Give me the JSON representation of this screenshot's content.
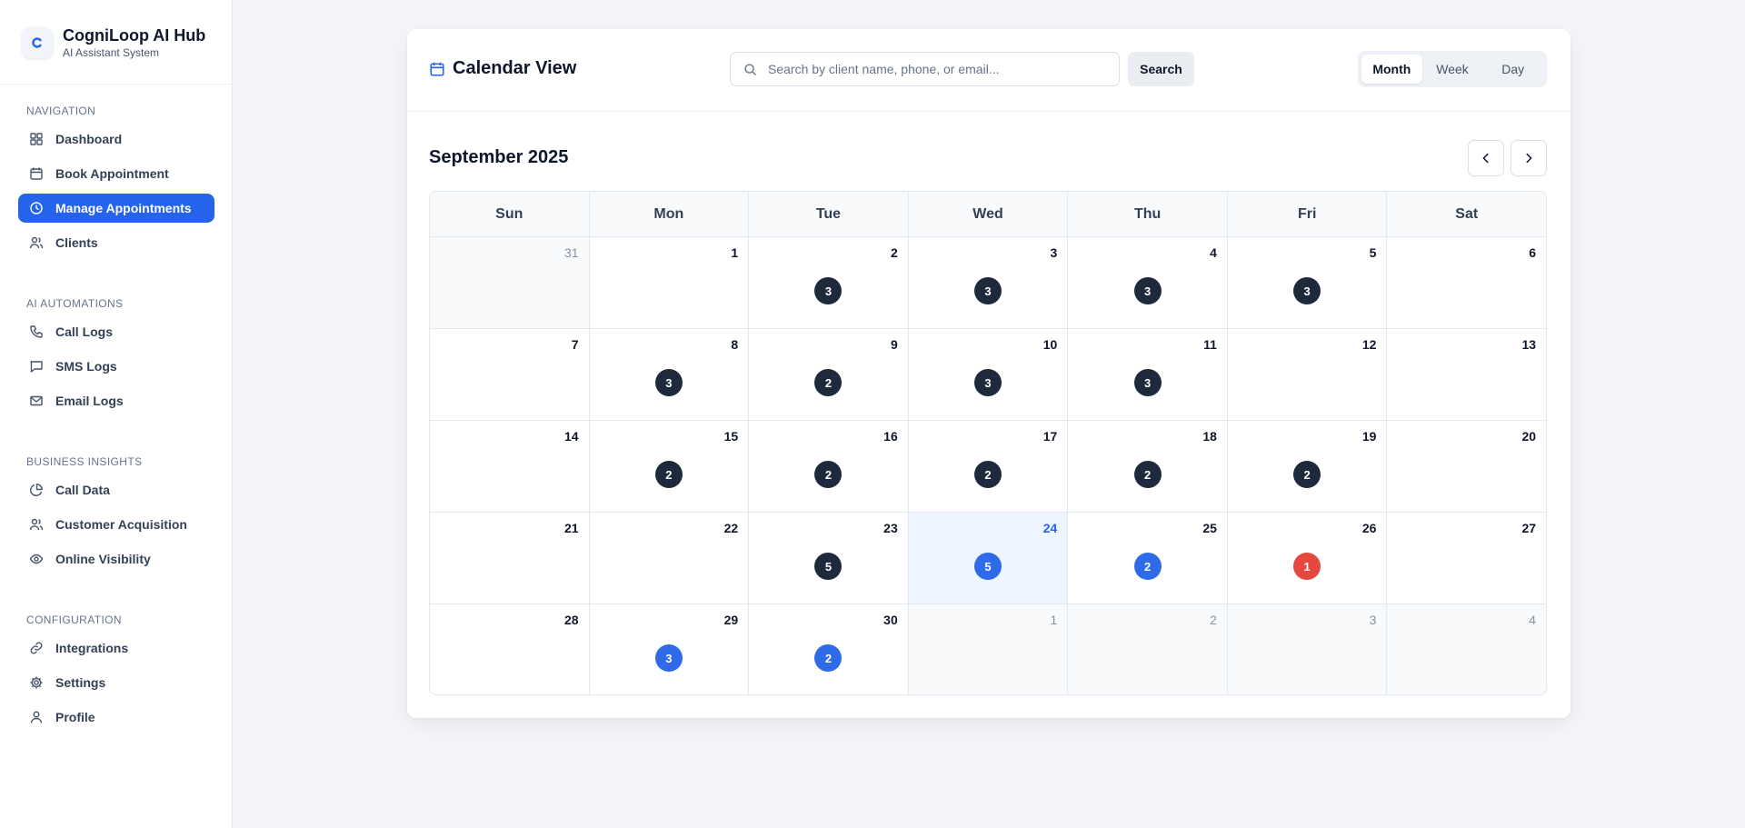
{
  "brand": {
    "name": "CogniLoop AI Hub",
    "subtitle": "AI Assistant System"
  },
  "sidebar": {
    "sections": [
      {
        "title": "NAVIGATION",
        "items": [
          {
            "label": "Dashboard",
            "icon": "dashboard-icon"
          },
          {
            "label": "Book Appointment",
            "icon": "calendar-icon"
          },
          {
            "label": "Manage Appointments",
            "icon": "clock-icon",
            "active": true
          },
          {
            "label": "Clients",
            "icon": "users-icon"
          }
        ]
      },
      {
        "title": "AI AUTOMATIONS",
        "items": [
          {
            "label": "Call Logs",
            "icon": "phone-icon"
          },
          {
            "label": "SMS Logs",
            "icon": "message-icon"
          },
          {
            "label": "Email Logs",
            "icon": "mail-icon"
          }
        ]
      },
      {
        "title": "BUSINESS INSIGHTS",
        "items": [
          {
            "label": "Call Data",
            "icon": "pie-chart-icon"
          },
          {
            "label": "Customer Acquisition",
            "icon": "users-icon"
          },
          {
            "label": "Online Visibility",
            "icon": "eye-icon"
          }
        ]
      },
      {
        "title": "CONFIGURATION",
        "items": [
          {
            "label": "Integrations",
            "icon": "link-icon"
          },
          {
            "label": "Settings",
            "icon": "gear-icon"
          },
          {
            "label": "Profile",
            "icon": "user-icon"
          }
        ]
      }
    ]
  },
  "calendar": {
    "title": "Calendar View",
    "search_placeholder": "Search by client name, phone, or email...",
    "search_label": "Search",
    "views": [
      "Month",
      "Week",
      "Day"
    ],
    "selected_view": "Month",
    "month_label": "September 2025",
    "weekdays": [
      "Sun",
      "Mon",
      "Tue",
      "Wed",
      "Thu",
      "Fri",
      "Sat"
    ],
    "weeks": [
      [
        {
          "day": "31",
          "other": true
        },
        {
          "day": "1"
        },
        {
          "day": "2",
          "count": "3"
        },
        {
          "day": "3",
          "count": "3"
        },
        {
          "day": "4",
          "count": "3"
        },
        {
          "day": "5",
          "count": "3"
        },
        {
          "day": "6"
        }
      ],
      [
        {
          "day": "7"
        },
        {
          "day": "8",
          "count": "3"
        },
        {
          "day": "9",
          "count": "2"
        },
        {
          "day": "10",
          "count": "3"
        },
        {
          "day": "11",
          "count": "3"
        },
        {
          "day": "12"
        },
        {
          "day": "13"
        }
      ],
      [
        {
          "day": "14"
        },
        {
          "day": "15",
          "count": "2"
        },
        {
          "day": "16",
          "count": "2"
        },
        {
          "day": "17",
          "count": "2"
        },
        {
          "day": "18",
          "count": "2"
        },
        {
          "day": "19",
          "count": "2"
        },
        {
          "day": "20"
        }
      ],
      [
        {
          "day": "21"
        },
        {
          "day": "22"
        },
        {
          "day": "23",
          "count": "5"
        },
        {
          "day": "24",
          "count": "5",
          "today": true,
          "status": "blue"
        },
        {
          "day": "25",
          "count": "2",
          "status": "blue"
        },
        {
          "day": "26",
          "count": "1",
          "status": "red"
        },
        {
          "day": "27"
        }
      ],
      [
        {
          "day": "28"
        },
        {
          "day": "29",
          "count": "3",
          "status": "blue"
        },
        {
          "day": "30",
          "count": "2",
          "status": "blue"
        },
        {
          "day": "1",
          "other": true
        },
        {
          "day": "2",
          "other": true
        },
        {
          "day": "3",
          "other": true
        },
        {
          "day": "4",
          "other": true
        }
      ]
    ]
  },
  "colors": {
    "accent": "#2563eb",
    "dark_badge": "#1e293b",
    "blue_badge": "#2f6be8",
    "red_badge": "#e5483e"
  }
}
